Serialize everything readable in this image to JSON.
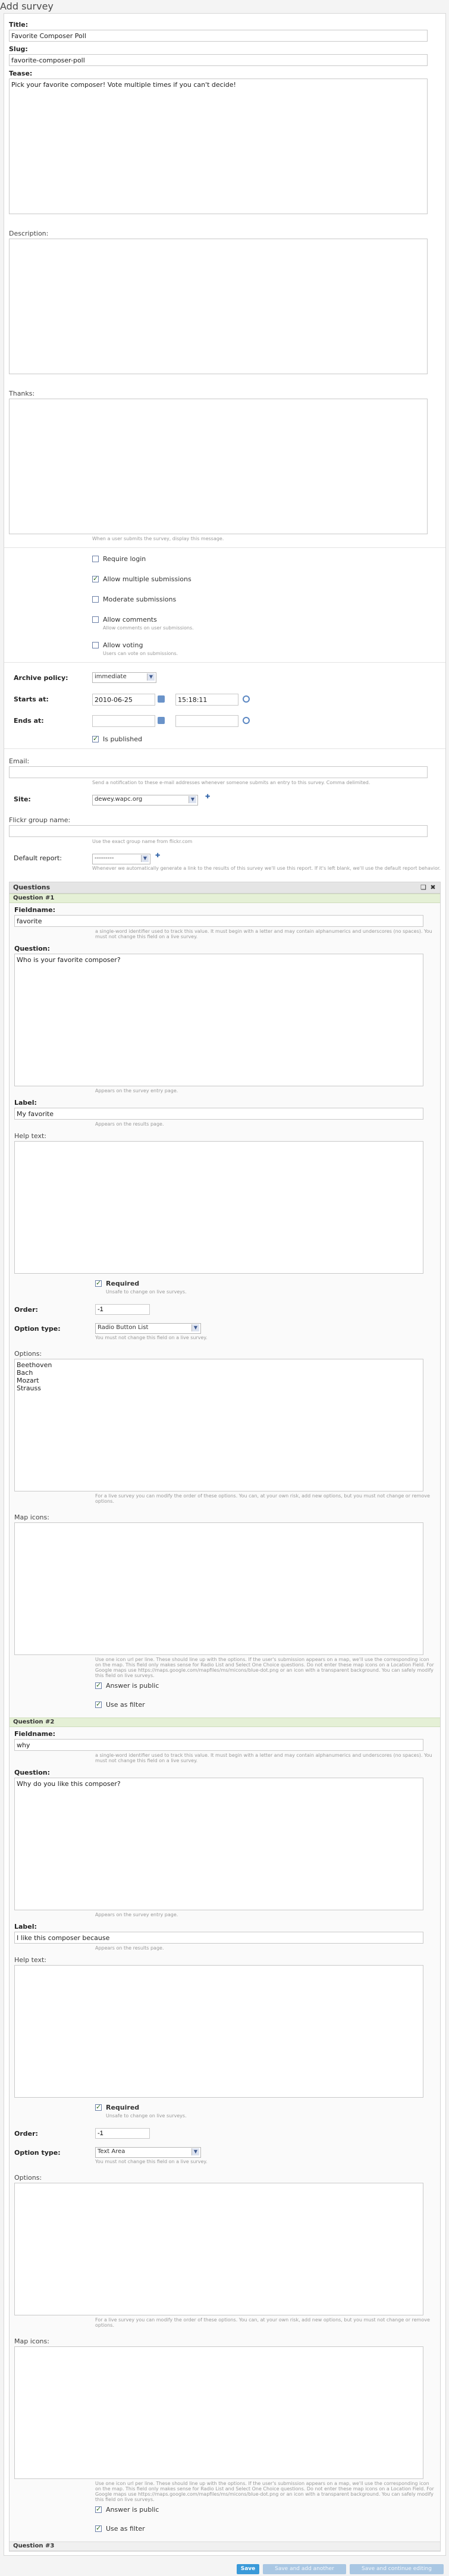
{
  "page": {
    "title": "Add survey"
  },
  "survey": {
    "title_label": "Title:",
    "title_value": "Favorite Composer Poll",
    "slug_label": "Slug:",
    "slug_value": "favorite-composer-poll",
    "tease_label": "Tease:",
    "tease_value": "Pick your favorite composer! Vote multiple times if you can't decide!",
    "description_label": "Description:",
    "thanks_label": "Thanks:",
    "thanks_help": "When a user submits the survey, display this message.",
    "options": [
      {
        "label": "Require login",
        "checked": false
      },
      {
        "label": "Allow multiple submissions",
        "checked": true
      },
      {
        "label": "Moderate submissions",
        "checked": false
      },
      {
        "label": "Allow comments",
        "checked": false,
        "help": "Allow comments on user submissions."
      },
      {
        "label": "Allow voting",
        "checked": false,
        "help": "Users can vote on submissions."
      }
    ],
    "archive_policy_label": "Archive policy:",
    "archive_policy_value": "immediate",
    "starts_at_label": "Starts at:",
    "starts_date": "2010-06-25",
    "starts_time": "15:18:11",
    "ends_at_label": "Ends at:",
    "is_published_label": "Is published",
    "email_label": "Email:",
    "email_help": "Send a notification to these e-mail addresses whenever someone submits an entry to this survey. Comma delimited.",
    "site_label": "Site:",
    "site_value": "dewey.wapc.org",
    "flickr_label": "Flickr group name:",
    "flickr_help": "Use the exact group name from flickr.com",
    "default_report_label": "Default report:",
    "default_report_value": "---------",
    "default_report_help": "Whenever we automatically generate a link to the results of this survey we'll use this report. If it's left blank, we'll use the default report behavior."
  },
  "questions": {
    "header": "Questions",
    "items": [
      {
        "group": "Question #1",
        "fieldname_label": "Fieldname:",
        "fieldname": "favorite",
        "fieldname_help": "a single-word identifier used to track this value. It must begin with a letter and may contain alphanumerics and underscores (no spaces). You must not change this field on a live survey.",
        "question_label": "Question:",
        "question": "Who is your favorite composer?",
        "question_help": "Appears on the survey entry page.",
        "label_label": "Label:",
        "label": "My favorite",
        "label_help": "Appears on the results page.",
        "helptext_label": "Help text:",
        "required_label": "Required",
        "required": true,
        "required_help": "Unsafe to change on live surveys.",
        "order_label": "Order:",
        "order": "-1",
        "option_type_label": "Option type:",
        "option_type": "Radio Button List",
        "option_type_help": "You must not change this field on a live survey.",
        "options_label": "Options:",
        "options": [
          "Beethoven",
          "Bach",
          "Mozart",
          "Strauss"
        ],
        "options_help": "For a live survey you can modify the order of these options. You can, at your own risk, add new options, but you must not change or remove options.",
        "map_icons_label": "Map icons:",
        "map_icons_help": "Use one icon url per line. These should line up with the options. If the user's submission appears on a map, we'll use the corresponding icon on the map. This field only makes sense for Radio List and Select One Choice questions. Do not enter these map icons on a Location Field. For Google maps use https://maps.google.com/mapfiles/ms/micons/blue-dot.png or an icon with a transparent background. You can safely modify this field on live surveys.",
        "answer_public_label": "Answer is public",
        "answer_public": true,
        "use_filter_label": "Use as filter",
        "use_filter": true
      },
      {
        "group": "Question #2",
        "fieldname_label": "Fieldname:",
        "fieldname": "why",
        "fieldname_help": "a single-word identifier used to track this value. It must begin with a letter and may contain alphanumerics and underscores (no spaces). You must not change this field on a live survey.",
        "question_label": "Question:",
        "question": "Why do you like this composer?",
        "question_help": "Appears on the survey entry page.",
        "label_label": "Label:",
        "label": "I like this composer because",
        "label_help": "Appears on the results page.",
        "helptext_label": "Help text:",
        "required_label": "Required",
        "required": true,
        "required_help": "Unsafe to change on live surveys.",
        "order_label": "Order:",
        "order": "-1",
        "option_type_label": "Option type:",
        "option_type": "Text Area",
        "option_type_help": "You must not change this field on a live survey.",
        "options_label": "Options:",
        "options": [],
        "options_help": "For a live survey you can modify the order of these options. You can, at your own risk, add new options, but you must not change or remove options.",
        "map_icons_label": "Map icons:",
        "map_icons_help": "Use one icon url per line. These should line up with the options. If the user's submission appears on a map, we'll use the corresponding icon on the map. This field only makes sense for Radio List and Select One Choice questions. Do not enter these map icons on a Location Field. For Google maps use https://maps.google.com/mapfiles/ms/micons/blue-dot.png or an icon with a transparent background. You can safely modify this field on live surveys.",
        "answer_public_label": "Answer is public",
        "answer_public": true,
        "use_filter_label": "Use as filter",
        "use_filter": true
      }
    ],
    "next_group": "Question #3"
  },
  "footer": {
    "save": "Save",
    "save_add_another": "Save and add another",
    "save_continue": "Save and continue editing"
  }
}
